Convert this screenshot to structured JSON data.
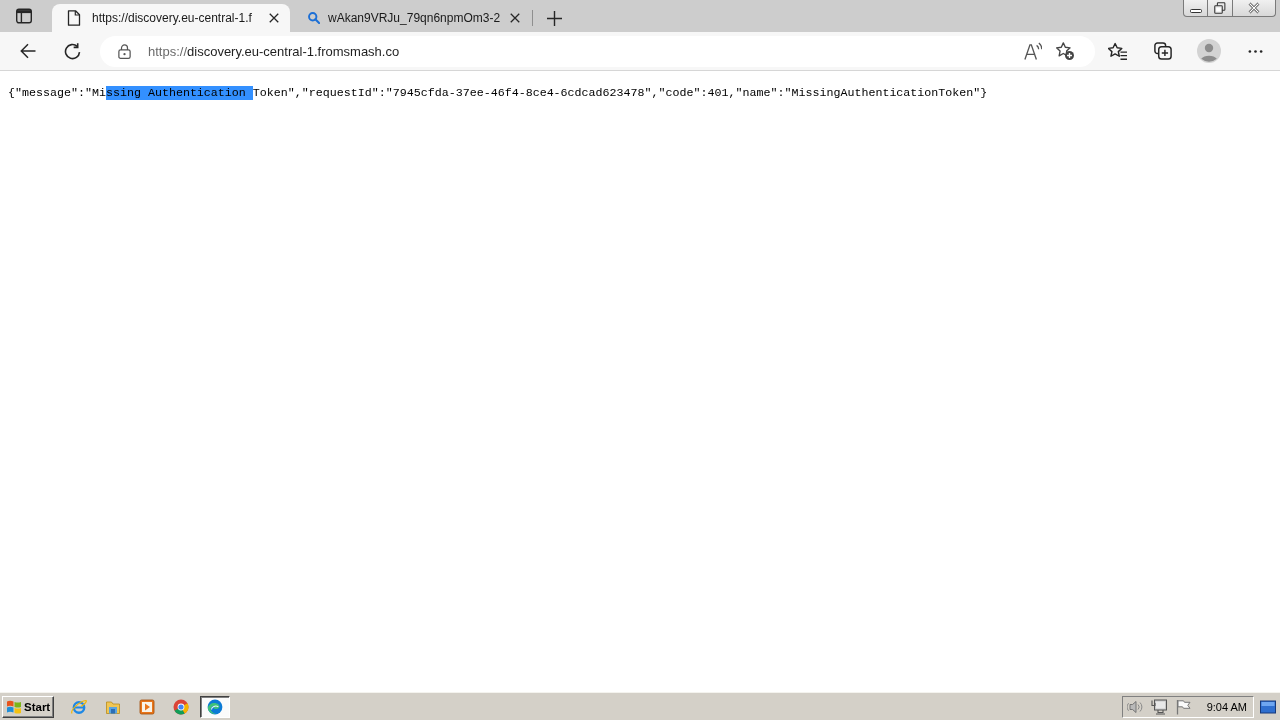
{
  "tabs": [
    {
      "kind": "page",
      "title": "https://discovery.eu-central-1.f",
      "selected": true
    },
    {
      "kind": "search",
      "title": "wAkan9VRJu_79qn6npmOm3-2",
      "selected": false
    }
  ],
  "address_bar": {
    "scheme": "https://",
    "host": "discovery.eu-central-1.fromsmash.co"
  },
  "page": {
    "segments": [
      {
        "text": "{\"message\":\"Mi",
        "selected": false
      },
      {
        "text": "ssing Authentication ",
        "selected": true
      },
      {
        "text": "Token\",\"requestId\":\"7945cfda-37ee-46f4-8ce4-6cdcad623478\",\"code\":401,\"name\":\"MissingAuthenticationToken\"}",
        "selected": false
      }
    ]
  },
  "taskbar": {
    "start": "Start",
    "apps": [
      {
        "kind": "globe",
        "selected": false
      },
      {
        "kind": "folder",
        "selected": false
      },
      {
        "kind": "player",
        "selected": false
      },
      {
        "kind": "wheel",
        "selected": false
      },
      {
        "kind": "swirl",
        "selected": true
      }
    ],
    "clock": "9:04 AM"
  }
}
